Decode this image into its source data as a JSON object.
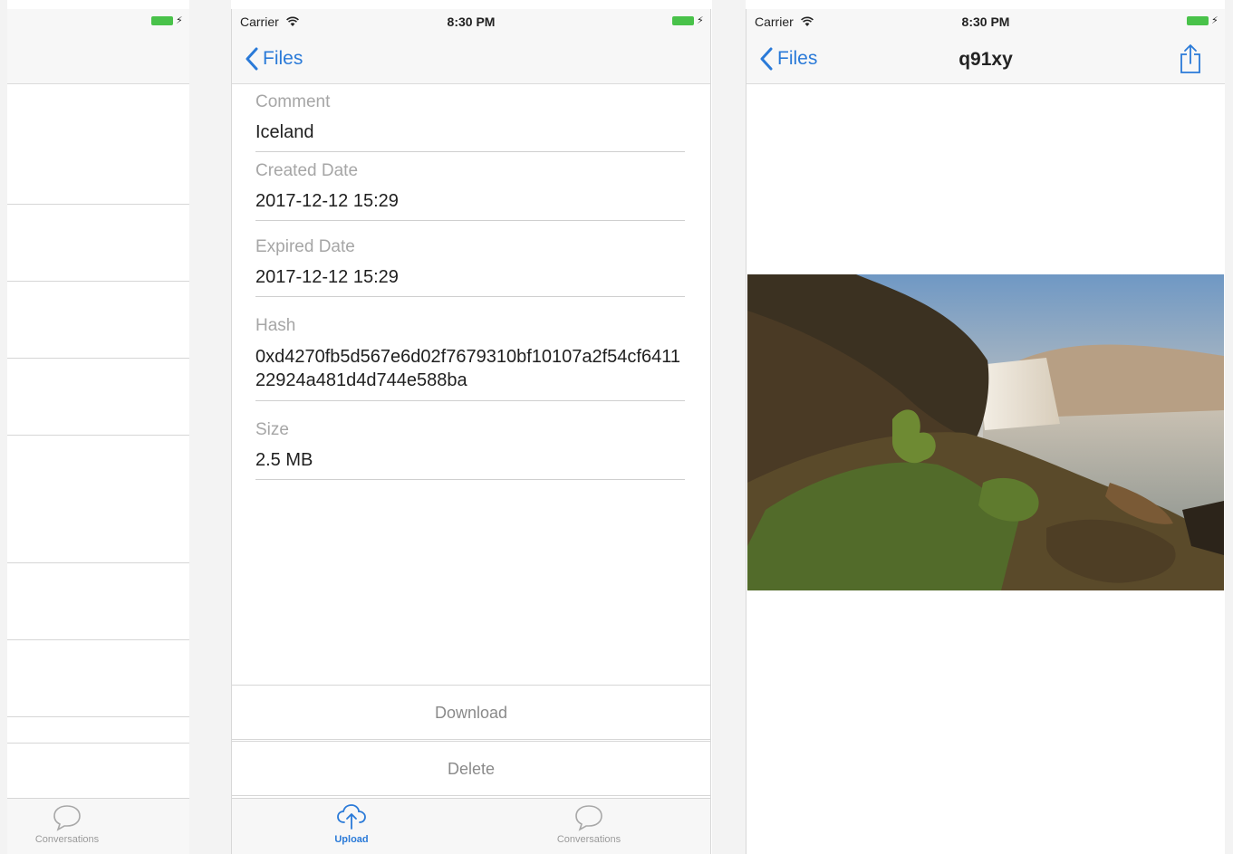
{
  "status": {
    "carrier": "Carrier",
    "time": "8:30 PM"
  },
  "detail": {
    "back_label": "Files",
    "fields": [
      {
        "label": "Comment",
        "value": "Iceland"
      },
      {
        "label": "Created Date",
        "value": "2017-12-12 15:29"
      },
      {
        "label": "Expired Date",
        "value": "2017-12-12 15:29"
      },
      {
        "label": "Hash",
        "value": "0xd4270fb5d567e6d02f7679310bf10107a2f54cf641122924a481d4d744e588ba"
      },
      {
        "label": "Size",
        "value": "2.5 MB"
      }
    ],
    "download_label": "Download",
    "delete_label": "Delete"
  },
  "preview": {
    "back_label": "Files",
    "title": "q91xy"
  },
  "tabs": {
    "upload": "Upload",
    "conversations": "Conversations"
  },
  "colors": {
    "accent": "#2a7ad8",
    "battery": "#49c24a",
    "label_gray": "#a6a6a6"
  },
  "icons": [
    "wifi-icon",
    "battery-icon",
    "back-chevron-icon",
    "share-icon",
    "upload-cloud-icon",
    "chat-bubble-icon"
  ]
}
